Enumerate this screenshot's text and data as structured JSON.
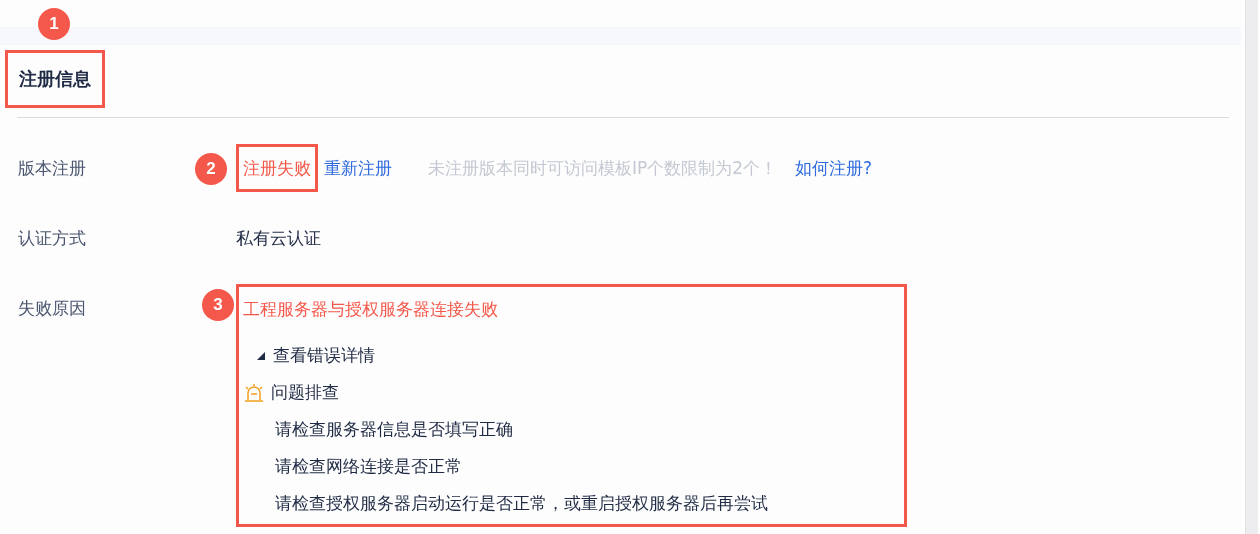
{
  "section": {
    "title": "注册信息",
    "annotation": "1"
  },
  "rows": [
    {
      "kind": "status",
      "label": "版本注册",
      "annotation": "2",
      "status": "注册失败",
      "action": "重新注册",
      "hint": "未注册版本同时可访问模板IP个数限制为2个！",
      "help_link": "如何注册?"
    },
    {
      "kind": "text",
      "label": "认证方式",
      "value": "私有云认证"
    },
    {
      "kind": "reason",
      "label": "失败原因",
      "annotation": "3",
      "error": "工程服务器与授权服务器连接失败",
      "details_toggle": "查看错误详情",
      "troubleshoot": {
        "title": "问题排查",
        "tips": [
          "请检查服务器信息是否填写正确",
          "请检查网络连接是否正常",
          "请检查授权服务器启动运行是否正常，或重启授权服务器后再尝试"
        ]
      }
    }
  ]
}
